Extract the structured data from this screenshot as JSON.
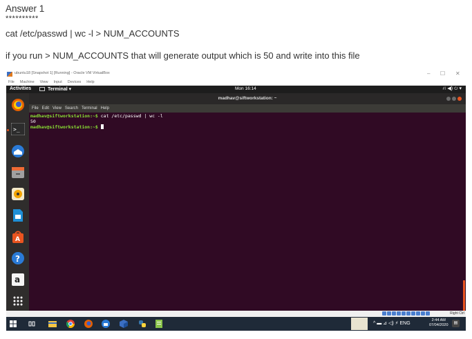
{
  "answer": {
    "title": "Answer 1",
    "stars": "**********",
    "command": "cat /etc/passwd | wc -l > NUM_ACCOUNTS",
    "explanation": "if you run > NUM_ACCOUNTS that will generate output which is 50 and write into this file"
  },
  "vbox": {
    "title": "ubuntu18 [Snapshot 1] [Running] - Oracle VM VirtualBox",
    "controls": {
      "minimize": "–",
      "maximize": "☐",
      "close": "✕"
    },
    "menu": [
      "File",
      "Machine",
      "View",
      "Input",
      "Devices",
      "Help"
    ],
    "hostkey": "Right Ctrl"
  },
  "ubuntu": {
    "activities": "Activities",
    "app_menu": "Terminal ▾",
    "clock": "Mon 16:14",
    "tray": "⛙  ◀) ⏻ ▾"
  },
  "terminal": {
    "title": "madhav@siftworkstation: ~",
    "menu": [
      "File",
      "Edit",
      "View",
      "Search",
      "Terminal",
      "Help"
    ],
    "lines": [
      {
        "prompt": "madhav@siftworkstation:~$",
        "text": " cat /etc/passwd | wc -l"
      },
      {
        "prompt": "",
        "text": "50"
      },
      {
        "prompt": "madhav@siftworkstation:~$",
        "text": " "
      }
    ]
  },
  "dock": {
    "items": [
      "firefox-icon",
      "terminal-icon",
      "thunderbird-icon",
      "files-icon",
      "rhythmbox-icon",
      "libreoffice-icon",
      "software-icon",
      "help-icon",
      "amazon-icon",
      "show-apps-icon"
    ]
  },
  "windows": {
    "tray": "^ ▬ ⊿ ◁) ⚡ ENG",
    "clock_time": "2:44 AM",
    "clock_date": "07/04/2020",
    "notification": "▤"
  }
}
